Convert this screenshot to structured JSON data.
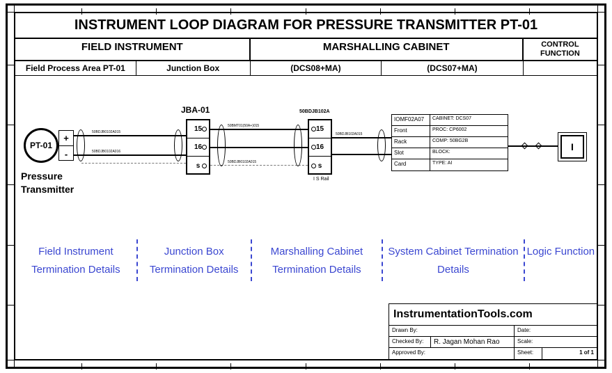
{
  "title": "INSTRUMENT LOOP DIAGRAM FOR PRESSURE TRANSMITTER PT-01",
  "headers": {
    "field": "FIELD INSTRUMENT",
    "marsh": "MARSHALLING CABINET",
    "ctrl": "CONTROL FUNCTION"
  },
  "subheaders": {
    "c1": "Field Process Area PT-01",
    "c2": "Junction Box",
    "c3": "(DCS08+MA)",
    "c4": "(DCS07+MA)",
    "c5": ""
  },
  "pt": {
    "tag": "PT-01",
    "name": "Pressure\nTransmitter",
    "plus": "+",
    "minus": "-"
  },
  "jb": {
    "label": "JBA-01",
    "t1": "15",
    "t2": "16",
    "t3": "s"
  },
  "marsh": {
    "label": "50BDJB102A",
    "t1": "15",
    "t2": "16",
    "t3": "s",
    "rail": "I S Rail"
  },
  "cabinet": {
    "r1a": "IOMF02A07",
    "r1b": "CABINET: DCS07",
    "r2a": "Front",
    "r2b": "PROC: CP6002",
    "r3a": "Rack",
    "r3b": "COMP: 50BG2B",
    "r4a": "Slot",
    "r4b": "BLOCK:",
    "r5a": "Card",
    "r5b": "TYPE: AI"
  },
  "logic": "I",
  "annot": {
    "a1": "Field Instrument Termination Details",
    "a2": "Junction Box Termination Details",
    "a3": "Marshalling Cabinet Termination Details",
    "a4": "System Cabinet Termination Details",
    "a5": "Logic Function"
  },
  "tblock": {
    "brand": "InstrumentationTools.com",
    "drawn": "Drawn By:",
    "date": "Date:",
    "checked": "Checked By:",
    "checkedval": "R. Jagan Mohan Rao",
    "scale": "Scale:",
    "approved": "Approved By:",
    "sheet": "Sheet:",
    "sheetval": "1 of 1"
  }
}
